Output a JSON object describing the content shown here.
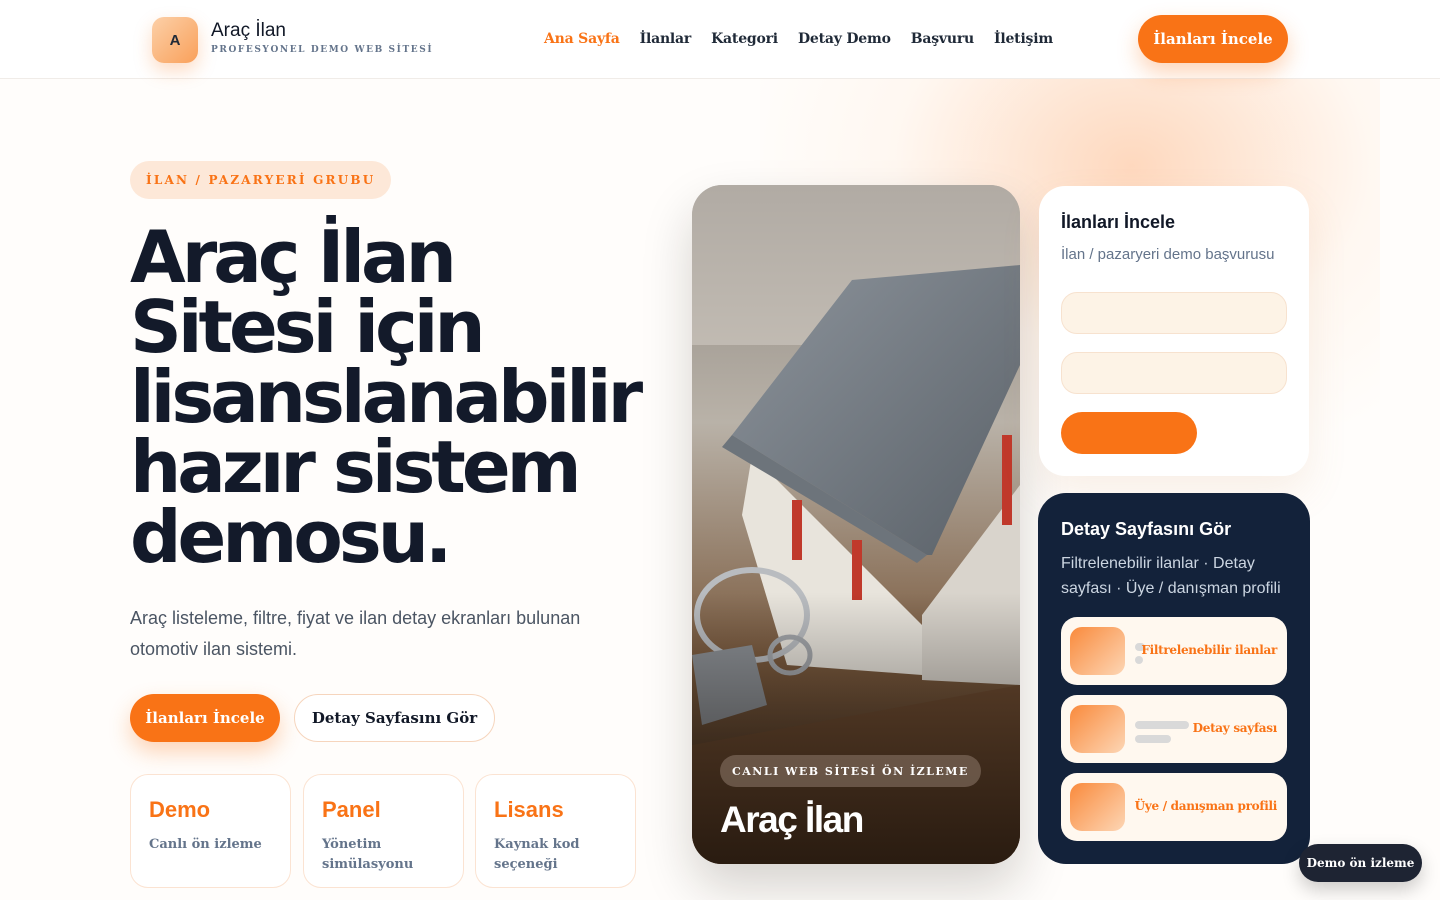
{
  "header": {
    "logo_letter": "A",
    "brand_name": "Araç İlan",
    "brand_sub": "PROFESYONEL DEMO WEB SİTESİ",
    "nav": [
      {
        "label": "Ana Sayfa",
        "active": true
      },
      {
        "label": "İlanlar"
      },
      {
        "label": "Kategori"
      },
      {
        "label": "Detay Demo"
      },
      {
        "label": "Başvuru"
      },
      {
        "label": "İletişim"
      }
    ],
    "cta_label": "İlanları İncele"
  },
  "hero": {
    "tag": "İLAN / PAZARYERİ GRUBU",
    "title_lines": [
      "Araç İlan",
      "Sitesi için",
      "lisanslanabilir",
      "hazır sistem",
      "demosu."
    ],
    "description": "Araç listeleme, filtre, fiyat ve ilan detay ekranları bulunan otomotiv ilan sistemi.",
    "primary_button": "İlanları İncele",
    "secondary_button": "Detay Sayfasını Gör",
    "stats": [
      {
        "title": "Demo",
        "subtitle": "Canlı ön izleme"
      },
      {
        "title": "Panel",
        "subtitle": "Yönetim simülasyonu"
      },
      {
        "title": "Lisans",
        "subtitle": "Kaynak kod seçeneği"
      }
    ]
  },
  "preview": {
    "pill": "CANLI WEB SİTESİ ÖN İZLEME",
    "title": "Araç İlan"
  },
  "form_card": {
    "title": "İlanları İncele",
    "subtitle": "İlan / pazaryeri demo başvurusu"
  },
  "detail_card": {
    "title": "Detay Sayfasını Gör",
    "description": "Filtrelenebilir ilanlar · Detay sayfası · Üye / danışman profili",
    "features": [
      {
        "label": "Filtrelenebilir ilanlar"
      },
      {
        "label": "Detay sayfası"
      },
      {
        "label": "Üye / danışman profili"
      }
    ]
  },
  "floating": {
    "demo_label": "Demo ön izleme"
  },
  "colors": {
    "accent": "#f97316",
    "dark_card": "#13223a",
    "text": "#131a2a"
  }
}
